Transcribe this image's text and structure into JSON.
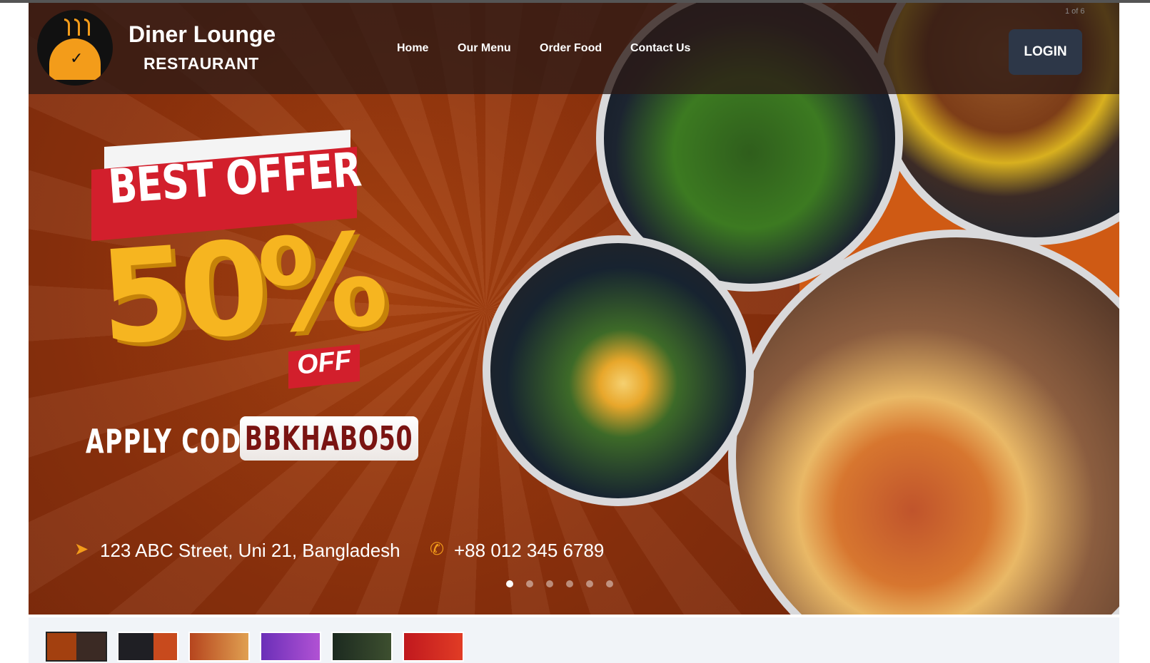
{
  "header": {
    "brand_name": "Diner Lounge",
    "brand_sub": "RESTAURANT",
    "nav": [
      "Home",
      "Our Menu",
      "Order Food",
      "Contact Us"
    ],
    "login_label": "LOGIN",
    "slide_counter": "1 of 6"
  },
  "slide": {
    "offer_label": "BEST OFFER",
    "percent": "50%",
    "off_label": "OFF",
    "apply_label": "APPLY CODE",
    "code": "BBKHABO50",
    "address": "123 ABC Street, Uni 21, Bangladesh",
    "phone": "+88 012 345 6789",
    "address_icon": "location-arrow-icon",
    "phone_icon": "phone-icon"
  },
  "slider": {
    "dot_count": 6,
    "active_index": 0,
    "thumbnail_count": 6
  },
  "colors": {
    "brand_orange": "#f39c1a",
    "offer_red": "#d21f2c",
    "percent_yellow": "#f6b520",
    "login_bg": "#2d3748"
  }
}
